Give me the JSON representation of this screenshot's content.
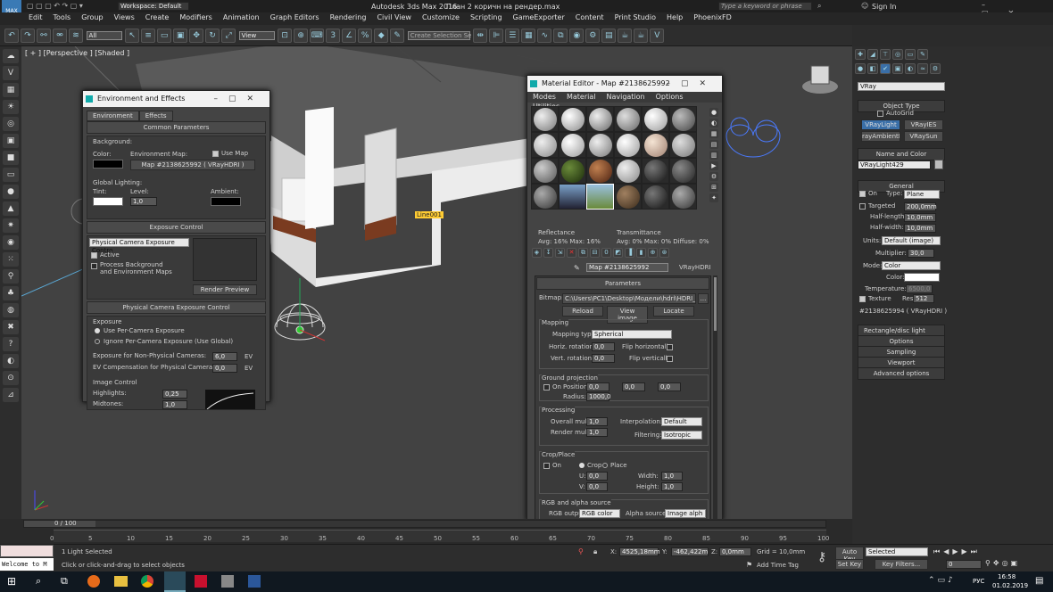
{
  "titlebar": {
    "workspace": "Workspace: Default",
    "app": "Autodesk 3ds Max 2016",
    "file": "План 2 коричн на рендер.max",
    "search_placeholder": "Type a keyword or phrase",
    "signin": "Sign In"
  },
  "menu": [
    "Edit",
    "Tools",
    "Group",
    "Views",
    "Create",
    "Modifiers",
    "Animation",
    "Graph Editors",
    "Rendering",
    "Civil View",
    "Customize",
    "Scripting",
    "GameExporter",
    "Content",
    "Print Studio",
    "Help",
    "PhoenixFD"
  ],
  "toolbar": {
    "filter": "All",
    "refcoord": "View",
    "selset": "Create Selection Se"
  },
  "viewport": {
    "label": "[ + ] [Perspective ] [Shaded ]",
    "obj_label": "Line001"
  },
  "env": {
    "title": "Environment and Effects",
    "tabs": [
      "Environment",
      "Effects"
    ],
    "common": "Common Parameters",
    "background": "Background:",
    "color": "Color:",
    "envmap": "Environment Map:",
    "usemap": "Use Map",
    "mapname": "Map #2138625992  ( VRayHDRI )",
    "global": "Global Lighting:",
    "tint": "Tint:",
    "level": "Level:",
    "level_val": "1,0",
    "ambient": "Ambient:",
    "exposure": "Exposure Control",
    "exposure_sel": "Physical Camera Exposure Contro",
    "active": "Active",
    "procbg": "Process Background\nand Environment Maps",
    "render_preview": "Render Preview",
    "phys": "Physical Camera Exposure Control",
    "exposure_lbl": "Exposure",
    "use_per": "Use Per-Camera Exposure",
    "ignore_per": "Ignore Per-Camera Exposure (Use Global)",
    "nonphys": "Exposure for Non-Physical Cameras:",
    "nonphys_val": "6,0",
    "ev": "EV",
    "evcomp": "EV Compensation for Physical Cameras:",
    "evcomp_val": "0,0",
    "imgctrl": "Image Control",
    "highlights": "Highlights:",
    "highlights_val": "0,25",
    "midtones": "Midtones:",
    "midtones_val": "1,0"
  },
  "mat": {
    "title": "Material Editor - Map #2138625992",
    "menus": [
      "Modes",
      "Material",
      "Navigation",
      "Options",
      "Utilities"
    ],
    "reflectance": "Reflectance",
    "refl_vals": "Avg:  16% Max:  16%",
    "transmittance": "Transmittance",
    "trans_vals": "Avg:   0% Max:   0%  Diffuse:   0%",
    "mapname": "Map #2138625992",
    "maptype": "VRayHDRI",
    "params": "Parameters",
    "bitmap": "Bitmap:",
    "bitmap_path": "C:\\Users\\PC1\\Desktop\\Модели\\hdri\\HDRI_Panor",
    "reload": "Reload",
    "viewimage": "View image",
    "locate": "Locate",
    "mapping": "Mapping",
    "maptype_lbl": "Mapping type:",
    "maptype_val": "Spherical",
    "horiz": "Horiz. rotation:",
    "horiz_val": "0,0",
    "flip_h": "Flip horizontally",
    "vert": "Vert. rotation:",
    "vert_val": "0,0",
    "flip_v": "Flip vertically",
    "ground": "Ground projection",
    "on": "On",
    "position": "Position:",
    "pos_vals": [
      "0,0",
      "0,0",
      "0,0"
    ],
    "radius": "Radius:",
    "radius_val": "1000,0",
    "processing": "Processing",
    "overall": "Overall mult:",
    "overall_val": "1,0",
    "interp": "Interpolation:",
    "interp_val": "Default",
    "render": "Render mult:",
    "render_val": "1,0",
    "filtering": "Filtering:",
    "filtering_val": "Isotropic",
    "crop": "Crop/Place",
    "crop_on": "On",
    "crop_opt": "Crop",
    "place_opt": "Place",
    "u": "U:",
    "u_val": "0,0",
    "v": "V:",
    "v_val": "0,0",
    "width": "Width:",
    "width_val": "1,0",
    "height": "Height:",
    "height_val": "1,0",
    "rgb": "RGB and alpha source",
    "rgbout": "RGB output:",
    "rgbout_val": "RGB color",
    "alphasrc": "Alpha source:",
    "alphasrc_val": "Image alph"
  },
  "cmd": {
    "category": "VRay",
    "objtype": "Object Type",
    "autogrid": "AutoGrid",
    "buttons": [
      "VRayLight",
      "VRayIES",
      "rayAmbientLig",
      "VRaySun"
    ],
    "namecolor": "Name and Color",
    "objname": "VRayLight429",
    "general": "General",
    "on": "On",
    "type": "Type:",
    "type_val": "Plane",
    "targeted": "Targeted",
    "targeted_val": "200,0mm",
    "halflen": "Half-length:",
    "halflen_val": "10,0mm",
    "halfwid": "Half-width:",
    "halfwid_val": "10,0mm",
    "units": "Units:",
    "units_val": "Default (image)",
    "mult": "Multiplier:",
    "mult_val": "30,0",
    "mode": "Mode:",
    "mode_val": "Color",
    "color": "Color:",
    "temp": "Temperature:",
    "temp_val": "6500,0",
    "texture": "Texture",
    "res": "Res:",
    "res_val": "512",
    "texmap": "#2138625994  ( VRayHDRI )",
    "rollouts": [
      "Rectangle/disc light",
      "Options",
      "Sampling",
      "Viewport",
      "Advanced options"
    ]
  },
  "timeline": {
    "frame": "0 / 100",
    "ticks": [
      "0",
      "5",
      "10",
      "15",
      "20",
      "25",
      "30",
      "35",
      "40",
      "45",
      "50",
      "55",
      "60",
      "65",
      "70",
      "75",
      "80",
      "85",
      "90",
      "95",
      "100"
    ]
  },
  "status": {
    "selected": "1 Light Selected",
    "hint": "Click or click-and-drag to select objects",
    "maxscript": "Welcome to M",
    "x": "4525,18mm",
    "y": "-462,422m",
    "z": "0,0mm",
    "grid": "Grid = 10,0mm",
    "addtime": "Add Time Tag",
    "autokey": "Auto Key",
    "selected_drop": "Selected",
    "setkey": "Set Key",
    "keyfilters": "Key Filters...",
    "frame_field": "0"
  },
  "taskbar": {
    "lang": "РУС",
    "time": "16:58",
    "date": "01.02.2019"
  }
}
